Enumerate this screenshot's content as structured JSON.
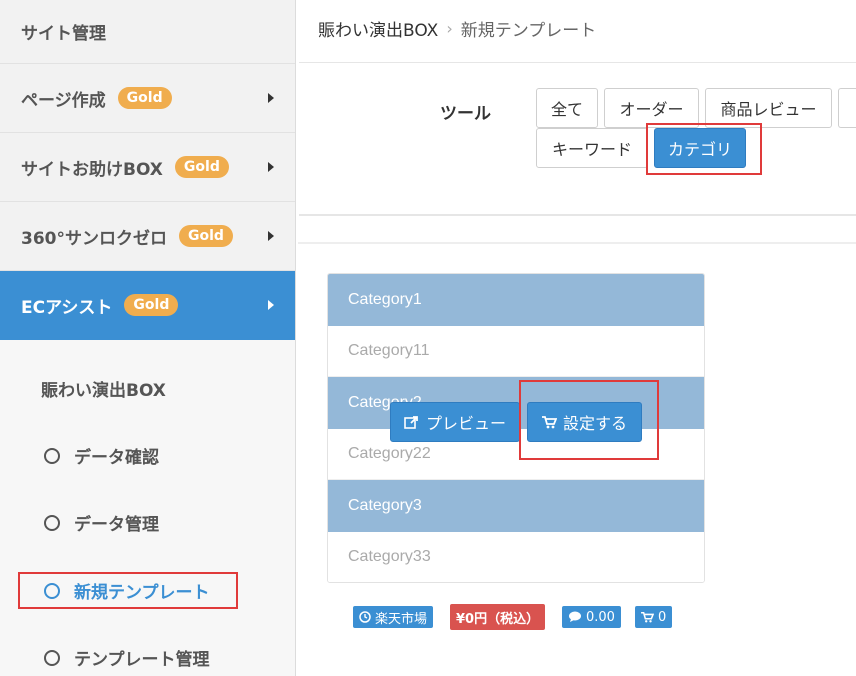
{
  "sidebar": {
    "header": "サイト管理",
    "badge": "Gold",
    "items": [
      {
        "label": "ページ作成",
        "badge": "Gold"
      },
      {
        "label": "サイトお助けBOX",
        "badge": "Gold"
      },
      {
        "label": "360°サンロクゼロ",
        "badge": "Gold"
      },
      {
        "label": "ECアシスト",
        "badge": "Gold",
        "active": true
      }
    ],
    "submenu_title": "賑わい演出BOX",
    "submenu": [
      {
        "label": "データ確認"
      },
      {
        "label": "データ管理"
      },
      {
        "label": "新規テンプレート",
        "current": true
      },
      {
        "label": "テンプレート管理"
      }
    ]
  },
  "breadcrumb": {
    "parent": "賑わい演出BOX",
    "separator": "›",
    "current": "新規テンプレート"
  },
  "tools": {
    "label": "ツール",
    "buttons": [
      "全て",
      "オーダー",
      "商品レビュー",
      "キーワード",
      "カテゴリ"
    ],
    "active": "カテゴリ"
  },
  "preview": {
    "categories": [
      {
        "name": "Category1",
        "child": "Category11"
      },
      {
        "name": "Category2",
        "child": "Category22"
      },
      {
        "name": "Category3",
        "child": "Category33"
      }
    ],
    "preview_button": "プレビュー",
    "set_button": "設定する"
  },
  "footer_badges": {
    "market": "楽天市場",
    "price": "¥0円（税込）",
    "reviews": "0.00",
    "cart": "0"
  },
  "colors": {
    "accent": "#3b8fd3",
    "gold": "#f0ad4e",
    "category_header": "#94b8d8",
    "highlight": "#e03a3a",
    "price": "#d9534f"
  }
}
